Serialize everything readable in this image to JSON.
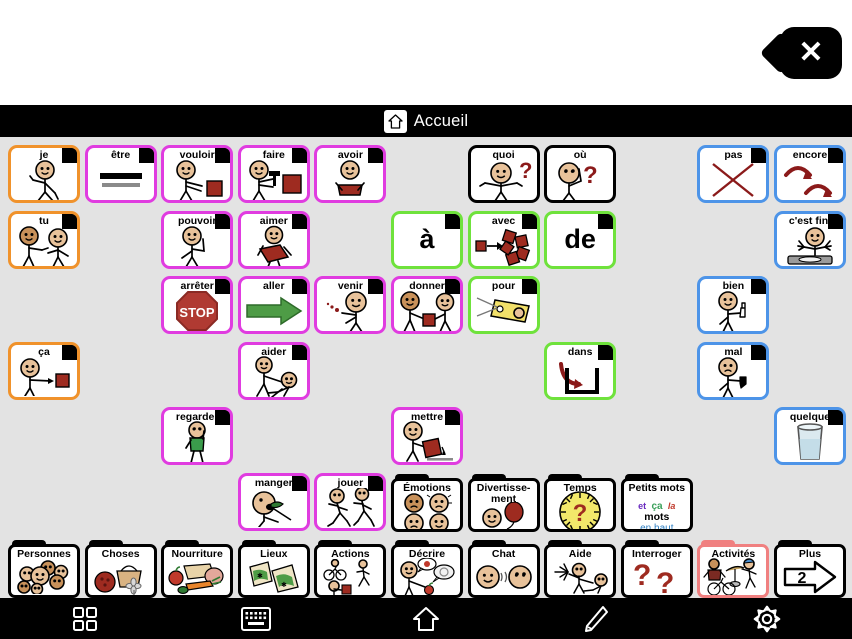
{
  "window": {
    "close_label": "✕",
    "close_icon": "close-icon"
  },
  "header": {
    "title": "Accueil",
    "home_icon": "home-icon"
  },
  "grid": {
    "columns": 11,
    "rows": 6,
    "background": "#e3e3e3",
    "border_colors": {
      "pronoun": "#f0922b",
      "verb": "#e03ce0",
      "preposition": "#6fe23c",
      "question": "#000000",
      "descriptor": "#4d94e8",
      "category": "#000000",
      "selected": "#f08080"
    },
    "cells": [
      {
        "label": "je",
        "col": 0,
        "row": 0,
        "type": "pronoun",
        "art": "person-point-self"
      },
      {
        "label": "être",
        "col": 1,
        "row": 0,
        "type": "verb",
        "art": "equals-bars"
      },
      {
        "label": "vouloir",
        "col": 2,
        "row": 0,
        "type": "verb",
        "art": "person-reach-block"
      },
      {
        "label": "faire",
        "col": 3,
        "row": 0,
        "type": "verb",
        "art": "person-hammer-block"
      },
      {
        "label": "avoir",
        "col": 4,
        "row": 0,
        "type": "verb",
        "art": "person-hold-block"
      },
      {
        "label": "quoi",
        "col": 6,
        "row": 0,
        "type": "question",
        "art": "person-shrug-question"
      },
      {
        "label": "où",
        "col": 7,
        "row": 0,
        "type": "question",
        "art": "person-look-question"
      },
      {
        "label": "pas",
        "col": 9,
        "row": 0,
        "type": "descriptor",
        "art": "red-cross"
      },
      {
        "label": "encore",
        "col": 10,
        "row": 0,
        "type": "descriptor",
        "art": "two-arrows-repeat"
      },
      {
        "label": "tu",
        "col": 0,
        "row": 1,
        "type": "pronoun",
        "art": "two-people-point"
      },
      {
        "label": "pouvoir",
        "col": 2,
        "row": 1,
        "type": "verb",
        "art": "person-flex-arm"
      },
      {
        "label": "aimer",
        "col": 3,
        "row": 1,
        "type": "verb",
        "art": "person-hug-heart"
      },
      {
        "label": "à",
        "col": 5,
        "row": 1,
        "type": "preposition",
        "art": "text-only"
      },
      {
        "label": "avec",
        "col": 6,
        "row": 1,
        "type": "preposition",
        "art": "blocks-join-arrow"
      },
      {
        "label": "de",
        "col": 7,
        "row": 1,
        "type": "preposition",
        "art": "text-only"
      },
      {
        "label": "c'est fini",
        "col": 10,
        "row": 1,
        "type": "descriptor",
        "art": "person-empty-table"
      },
      {
        "label": "arrêter",
        "col": 2,
        "row": 2,
        "type": "verb",
        "art": "stop-sign"
      },
      {
        "label": "aller",
        "col": 3,
        "row": 2,
        "type": "verb",
        "art": "green-arrow-right"
      },
      {
        "label": "venir",
        "col": 4,
        "row": 2,
        "type": "verb",
        "art": "person-beckon"
      },
      {
        "label": "donner",
        "col": 5,
        "row": 2,
        "type": "verb",
        "art": "two-people-give-block"
      },
      {
        "label": "pour",
        "col": 6,
        "row": 2,
        "type": "preposition",
        "art": "gift-tag"
      },
      {
        "label": "bien",
        "col": 9,
        "row": 2,
        "type": "descriptor",
        "art": "person-thumbs-up"
      },
      {
        "label": "ça",
        "col": 0,
        "row": 3,
        "type": "pronoun",
        "art": "person-point-block"
      },
      {
        "label": "aider",
        "col": 3,
        "row": 3,
        "type": "verb",
        "art": "person-help-person"
      },
      {
        "label": "dans",
        "col": 7,
        "row": 3,
        "type": "preposition",
        "art": "arrow-into-container"
      },
      {
        "label": "mal",
        "col": 9,
        "row": 3,
        "type": "descriptor",
        "art": "person-thumbs-down"
      },
      {
        "label": "regarder",
        "col": 2,
        "row": 4,
        "type": "verb",
        "art": "person-walking-look"
      },
      {
        "label": "mettre",
        "col": 5,
        "row": 4,
        "type": "verb",
        "art": "person-place-block"
      },
      {
        "label": "quelque",
        "col": 10,
        "row": 4,
        "type": "descriptor",
        "art": "glass-half-full"
      },
      {
        "label": "manger",
        "col": 3,
        "row": 5,
        "type": "verb",
        "art": "person-eating"
      },
      {
        "label": "jouer",
        "col": 4,
        "row": 5,
        "type": "verb",
        "art": "two-people-running"
      }
    ],
    "categories_row5": [
      {
        "label": "Émotions",
        "col": 5,
        "art": "four-faces"
      },
      {
        "label": "Divertisse-\nment",
        "col": 6,
        "art": "face-balloon",
        "two_line": true
      },
      {
        "label": "Temps",
        "col": 7,
        "art": "clock-question"
      },
      {
        "label": "Petits mots",
        "col": 8,
        "art": "little-words",
        "two_line": true,
        "words": [
          "et",
          "ça",
          "la",
          "mots",
          "en haut"
        ]
      }
    ],
    "categories_row6": [
      {
        "label": "Personnes",
        "col": 0,
        "art": "group-faces"
      },
      {
        "label": "Choses",
        "col": 1,
        "art": "basket-ball-toy"
      },
      {
        "label": "Nourriture",
        "col": 2,
        "art": "food-items"
      },
      {
        "label": "Lieux",
        "col": 3,
        "art": "maps"
      },
      {
        "label": "Actions",
        "col": 4,
        "art": "bike-run-figures"
      },
      {
        "label": "Décrire",
        "col": 5,
        "art": "person-speech-apple"
      },
      {
        "label": "Chat",
        "col": 6,
        "art": "two-faces-talk"
      },
      {
        "label": "Aide",
        "col": 7,
        "art": "hand-help-person"
      },
      {
        "label": "Interroger",
        "col": 8,
        "art": "two-question-marks"
      },
      {
        "label": "Activités",
        "col": 9,
        "art": "activity-figures",
        "selected": true
      },
      {
        "label": "Plus",
        "col": 10,
        "art": "arrow-right-page",
        "page_number": "2"
      }
    ]
  },
  "toolbar": {
    "items": [
      {
        "name": "apps-grid-icon",
        "label": "Grille"
      },
      {
        "name": "keyboard-icon",
        "label": "Clavier"
      },
      {
        "name": "home-icon",
        "label": "Accueil"
      },
      {
        "name": "pencil-icon",
        "label": "Éditer"
      },
      {
        "name": "gear-icon",
        "label": "Réglages"
      }
    ]
  }
}
